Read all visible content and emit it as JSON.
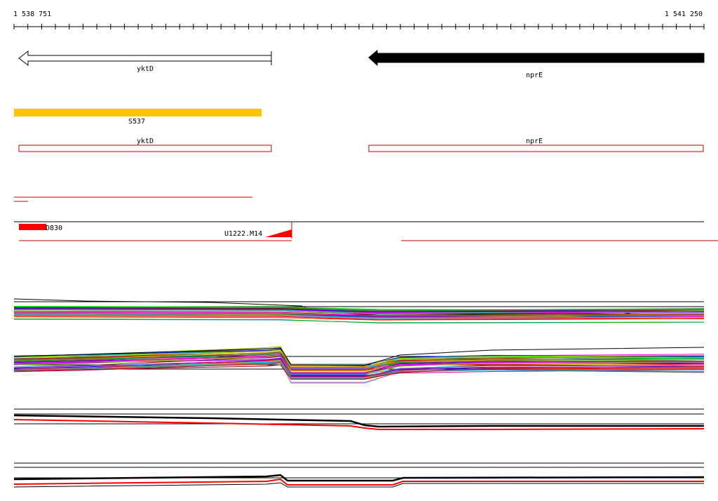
{
  "ruler": {
    "start_label": "1 538 751",
    "end_label": "1 541 250"
  },
  "genes": {
    "yktD": {
      "name": "yktD",
      "strand": "reverse",
      "style": "outline"
    },
    "nprE": {
      "name": "nprE",
      "strand": "reverse",
      "style": "filled"
    }
  },
  "segment": {
    "label": "S537",
    "color": "#ffc400"
  },
  "annotation_boxes": [
    {
      "label": "yktD",
      "color": "#cc0000"
    },
    {
      "label": "nprE",
      "color": "#cc0000"
    }
  ],
  "features": {
    "left_label": "D830",
    "right_label": "U1222.M14",
    "color": "#ff0000"
  },
  "colors": {
    "line": "#000000",
    "red": "#ff0000",
    "dark_red": "#cc0000"
  }
}
